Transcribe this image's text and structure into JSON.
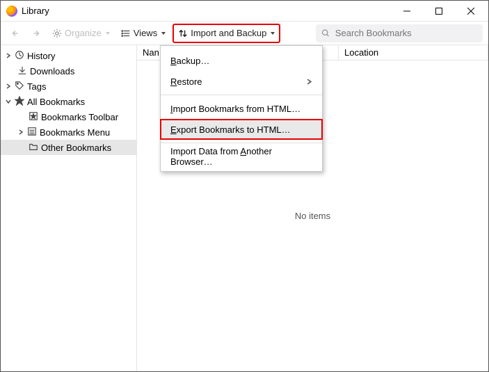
{
  "window": {
    "title": "Library"
  },
  "toolbar": {
    "organize": "Organize",
    "views": "Views",
    "import_backup": "Import and Backup",
    "search_placeholder": "Search Bookmarks"
  },
  "sidebar": {
    "history": "History",
    "downloads": "Downloads",
    "tags": "Tags",
    "all_bookmarks": "All Bookmarks",
    "bookmarks_toolbar": "Bookmarks Toolbar",
    "bookmarks_menu": "Bookmarks Menu",
    "other_bookmarks": "Other Bookmarks"
  },
  "columns": {
    "name": "Nan",
    "location": "Location"
  },
  "empty_msg": "No items",
  "menu": {
    "backup_pre": "",
    "backup_key": "B",
    "backup_post": "ackup…",
    "restore_pre": "",
    "restore_key": "R",
    "restore_post": "estore",
    "import_html_pre": "",
    "import_html_key": "I",
    "import_html_post": "mport Bookmarks from HTML…",
    "export_html_pre": "",
    "export_html_key": "E",
    "export_html_post": "xport Bookmarks to HTML…",
    "import_other_pre": "Import Data from ",
    "import_other_key": "A",
    "import_other_post": "nother Browser…"
  }
}
